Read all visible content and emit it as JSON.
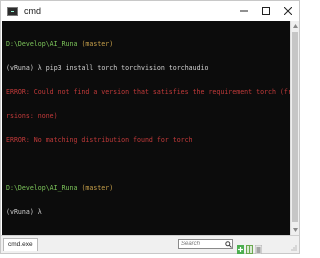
{
  "window": {
    "title": "cmd"
  },
  "terminal": {
    "lines": [
      {
        "type": "prompt",
        "path": "D:\\Develop\\AI_Runa",
        "branch": "(master)"
      },
      {
        "type": "command",
        "env": "(vRuna)",
        "symbol": "λ",
        "command": "pip3 install torch torchvision torchaudio"
      },
      {
        "type": "error",
        "text": "ERROR: Could not find a version that satisfies the requirement torch (from ve"
      },
      {
        "type": "error",
        "text": "rsions: none)"
      },
      {
        "type": "error",
        "text": "ERROR: No matching distribution found for torch"
      },
      {
        "type": "blank",
        "text": ""
      },
      {
        "type": "prompt",
        "path": "D:\\Develop\\AI_Runa",
        "branch": "(master)"
      },
      {
        "type": "command",
        "env": "(vRuna)",
        "symbol": "λ",
        "command": ""
      }
    ]
  },
  "statusbar": {
    "tab_label": "cmd.exe",
    "search_placeholder": "Search"
  },
  "icons": {
    "app": "terminal-icon",
    "minimize": "minimize-icon",
    "maximize": "maximize-icon",
    "close": "close-icon",
    "search": "search-icon",
    "add": "plus-icon",
    "split": "split-icon",
    "menu": "menu-icon"
  },
  "colors": {
    "terminal_bg": "#0c0c0c",
    "path_green": "#7cc45a",
    "branch_orange": "#c7a04a",
    "error_red": "#c23a3a",
    "text_white": "#d0d0d0"
  }
}
